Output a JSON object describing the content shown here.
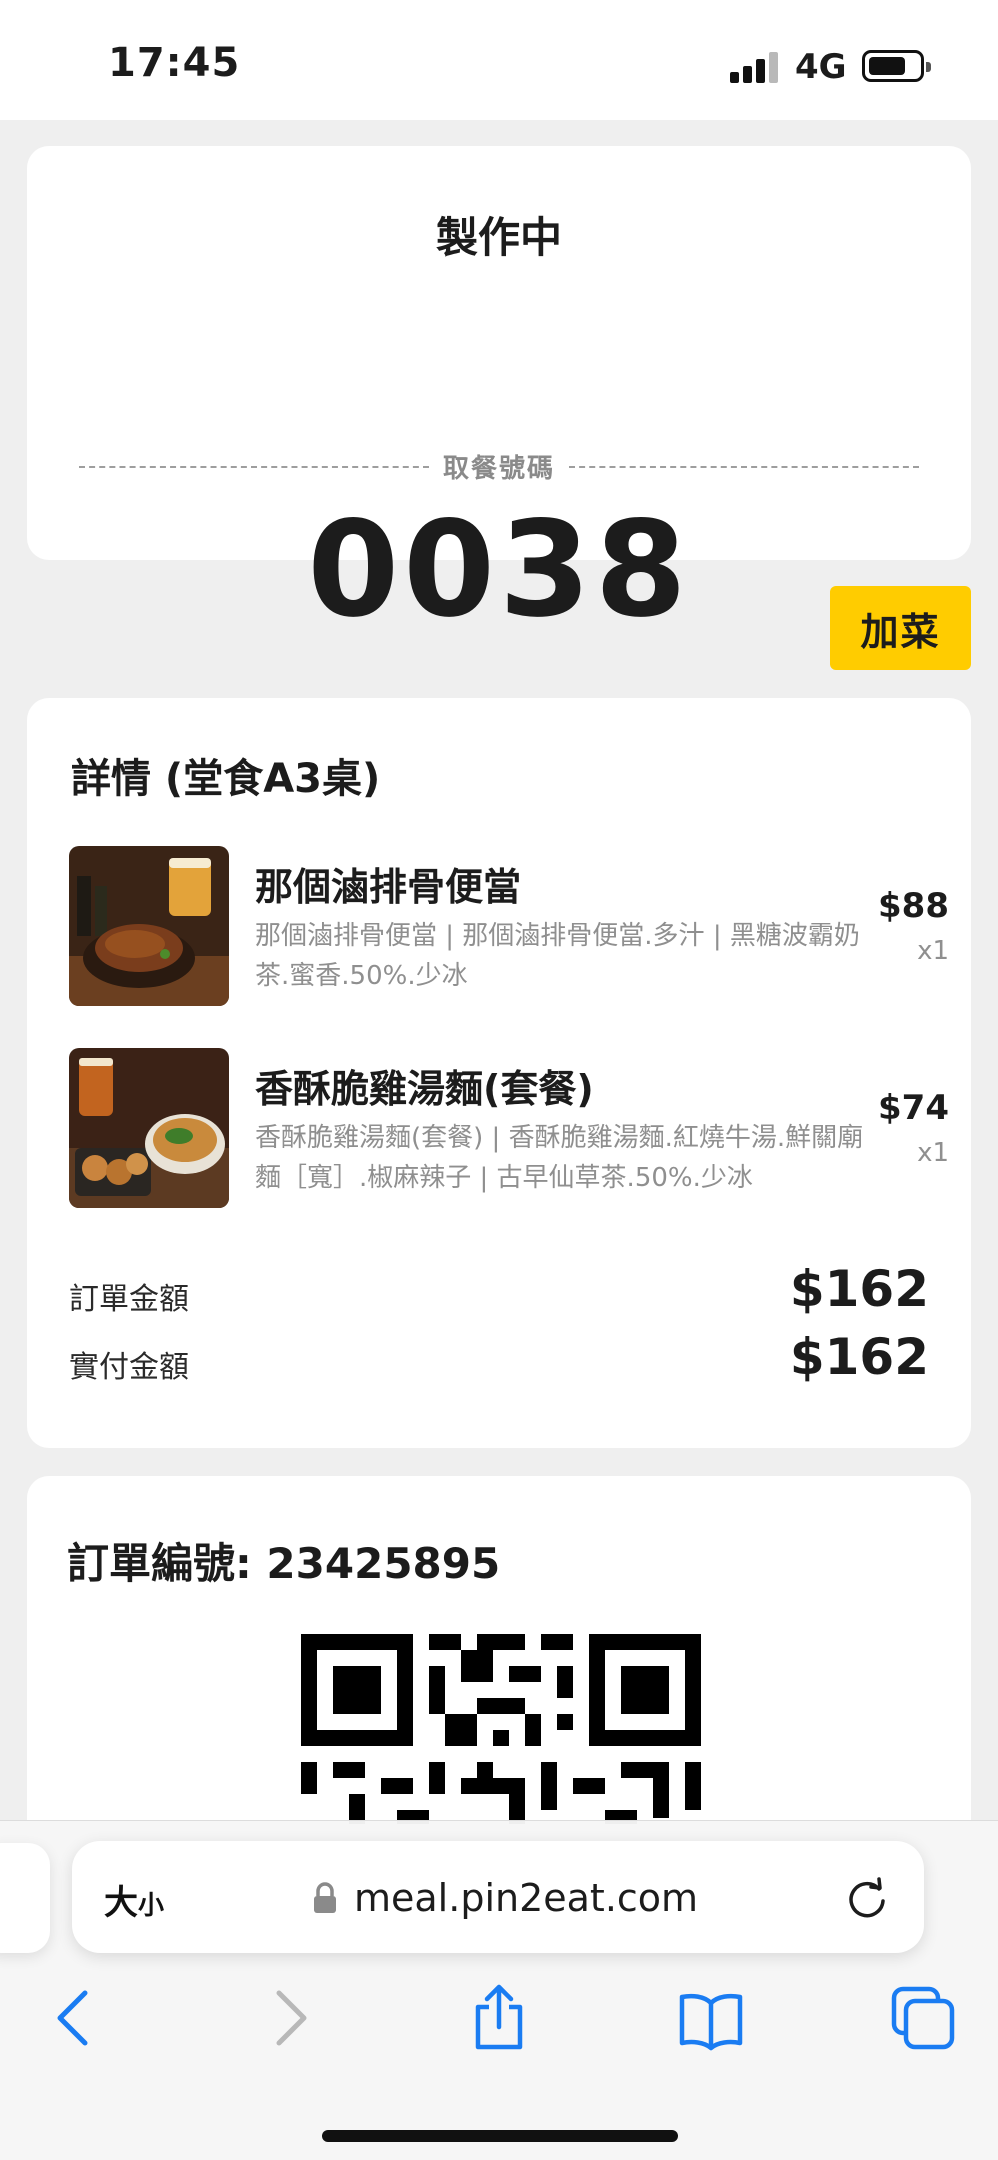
{
  "status_bar": {
    "time": "17:45",
    "network": "4G",
    "battery_fraction": 0.75,
    "signal_bars": 3
  },
  "pickup": {
    "status": "製作中",
    "label": "取餐號碼",
    "number": "0038"
  },
  "add_button": {
    "label": "加菜"
  },
  "details": {
    "heading": "詳情 (堂食A3桌)",
    "items": [
      {
        "name": "那個滷排骨便當",
        "description": "那個滷排骨便當 | 那個滷排骨便當.多汁 | 黑糖波霸奶茶.蜜香.50%.少冰",
        "price": "$88",
        "qty": "x1"
      },
      {
        "name": "香酥脆雞湯麵(套餐)",
        "description": "香酥脆雞湯麵(套餐) | 香酥脆雞湯麵.紅燒牛湯.鮮關廟麵［寬］.椒麻辣子 | 古早仙草茶.50%.少冰",
        "price": "$74",
        "qty": "x1"
      }
    ],
    "order_amount_label": "訂單金額",
    "order_amount": "$162",
    "paid_amount_label": "實付金額",
    "paid_amount": "$162"
  },
  "order": {
    "number_label": "訂單編號: 23425895"
  },
  "browser": {
    "text_size_big": "大",
    "text_size_small": "小",
    "url": "meal.pin2eat.com"
  },
  "colors": {
    "accent": "#ffcc00",
    "background": "#efefef",
    "ios_blue": "#1a7cf2"
  }
}
